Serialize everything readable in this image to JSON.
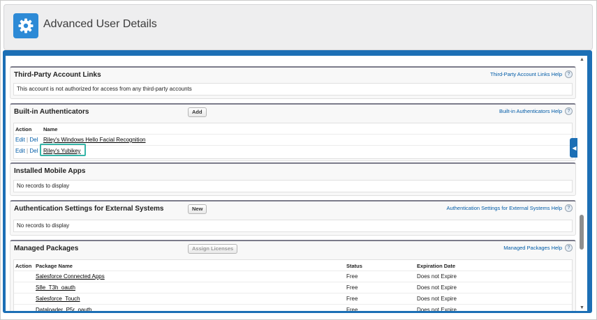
{
  "header": {
    "title": "Advanced User Details",
    "icon": "gear-icon"
  },
  "sections": {
    "third_party": {
      "title": "Third-Party Account Links",
      "help": "Third-Party Account Links Help",
      "message": "This account is not authorized for access from any third-party accounts"
    },
    "authenticators": {
      "title": "Built-in Authenticators",
      "add_label": "Add",
      "help": "Built-in Authenticators Help",
      "columns": [
        "Action",
        "Name"
      ],
      "rows": [
        {
          "edit": "Edit",
          "sep": "|",
          "del": "Del",
          "name": "Riley's Windows Hello Facial Recognition"
        },
        {
          "edit": "Edit",
          "sep": "|",
          "del": "Del",
          "name": "Riley's Yubikey"
        }
      ]
    },
    "mobile_apps": {
      "title": "Installed Mobile Apps",
      "message": "No records to display"
    },
    "auth_external": {
      "title": "Authentication Settings for External Systems",
      "new_label": "New",
      "help": "Authentication Settings for External Systems Help",
      "message": "No records to display"
    },
    "packages": {
      "title": "Managed Packages",
      "assign_label": "Assign Licenses",
      "help": "Managed Packages Help",
      "columns": [
        "Action",
        "Package Name",
        "Status",
        "Expiration Date"
      ],
      "rows": [
        {
          "name": "Salesforce Connected Apps",
          "status": "Free",
          "expiration": "Does not Expire"
        },
        {
          "name": "S8e_T3h_oauth",
          "status": "Free",
          "expiration": "Does not Expire"
        },
        {
          "name": "Salesforce_Touch",
          "status": "Free",
          "expiration": "Does not Expire"
        },
        {
          "name": "Dataloader_P5r_oauth",
          "status": "Free",
          "expiration": "Does not Expire"
        }
      ]
    }
  },
  "help_icon_glyph": "?",
  "colors": {
    "accent": "#1c6fb5",
    "icon_bg": "#2d8ad6",
    "highlight": "#35b5a8",
    "link": "#015ba7"
  }
}
